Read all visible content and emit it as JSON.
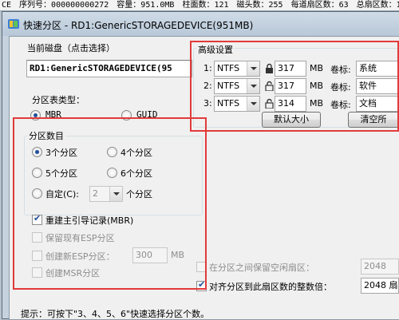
{
  "status_bar": {
    "items": [
      "CE",
      "序列号：000000000272",
      "容量：951.0MB",
      "柱面数：121",
      "磁头数：255",
      "每道扇区数：63",
      "总扇区数：1"
    ]
  },
  "dialog": {
    "title": "快速分区 - RD1:GenericSTORAGEDEVICE(951MB)"
  },
  "disk": {
    "label": "当前磁盘（点击选择）",
    "value": "RD1:GenericSTORAGEDEVICE(95"
  },
  "partition_table": {
    "label": "分区表类型：",
    "options": [
      {
        "label": "MBR",
        "selected": true
      },
      {
        "label": "GUID",
        "selected": false
      }
    ]
  },
  "partition_count": {
    "label": "分区数目",
    "options": [
      {
        "label": "3个分区",
        "selected": true
      },
      {
        "label": "4个分区",
        "selected": false
      },
      {
        "label": "5个分区",
        "selected": false
      },
      {
        "label": "6个分区",
        "selected": false
      }
    ],
    "custom_label": "自定(C):",
    "custom_value": "2",
    "custom_suffix": "个分区"
  },
  "options": {
    "rebuild_mbr": {
      "label": "重建主引导记录(MBR)",
      "checked": true
    },
    "keep_esp": {
      "label": "保留现有ESP分区",
      "checked": false
    },
    "create_esp": {
      "label": "创建新ESP分区：",
      "checked": false,
      "value": "300",
      "unit": "MB"
    },
    "create_msr": {
      "label": "创建MSR分区",
      "checked": false
    }
  },
  "advanced": {
    "label": "高级设置",
    "rows": [
      {
        "index": "1:",
        "fs": "NTFS",
        "size": "317",
        "unit": "MB",
        "vol_label": "卷标:",
        "vol_value": "系统",
        "locked": true
      },
      {
        "index": "2:",
        "fs": "NTFS",
        "size": "317",
        "unit": "MB",
        "vol_label": "卷标:",
        "vol_value": "软件",
        "locked": false
      },
      {
        "index": "3:",
        "fs": "NTFS",
        "size": "314",
        "unit": "MB",
        "vol_label": "卷标:",
        "vol_value": "文档",
        "locked": false
      }
    ],
    "default_size_button": "默认大小",
    "clear_button": "清空所"
  },
  "bottom_options": {
    "keep_free": {
      "label": "在分区之间保留空闲扇区：",
      "value": "2048",
      "checked": false
    },
    "align": {
      "label": "对齐分区到此扇区数的整数倍：",
      "value": "2048 扇区",
      "checked": true
    }
  },
  "hint": "提示：可按下\"3、4、5、6\"快速选择分区个数。",
  "colors": {
    "highlight": "#e23a3a",
    "accent": "#1f4e9c"
  }
}
